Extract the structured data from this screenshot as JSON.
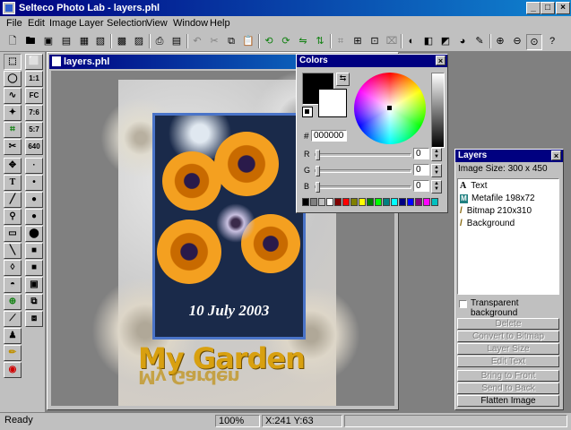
{
  "window": {
    "title": "Selteco Photo Lab - layers.phl",
    "min": "_",
    "max": "□",
    "close": "×"
  },
  "menu": [
    "File",
    "Edit",
    "Image",
    "Layer",
    "Selection",
    "View",
    "Window",
    "Help"
  ],
  "document": {
    "title": "layers.phl",
    "date_caption": "10 July 2003",
    "garden_text": "My Garden"
  },
  "colors_panel": {
    "title": "Colors",
    "hex_prefix": "#",
    "hex_value": "000000",
    "channels": [
      {
        "label": "R",
        "value": "0"
      },
      {
        "label": "G",
        "value": "0"
      },
      {
        "label": "B",
        "value": "0"
      }
    ],
    "swatches": [
      "#000000",
      "#808080",
      "#c0c0c0",
      "#ffffff",
      "#800000",
      "#ff0000",
      "#808000",
      "#ffff00",
      "#008000",
      "#00ff00",
      "#008080",
      "#00ffff",
      "#000080",
      "#0000ff",
      "#800080",
      "#ff00ff",
      "#00c0c0"
    ]
  },
  "layers_panel": {
    "title": "Layers",
    "image_size": "Image Size: 300 x 450",
    "items": [
      {
        "icon": "A",
        "label": "Text"
      },
      {
        "icon": "M",
        "label": "Metafile 198x72"
      },
      {
        "icon": "/",
        "label": "Bitmap 210x310"
      },
      {
        "icon": "/",
        "label": "Background"
      }
    ],
    "transparent_label": "Transparent background",
    "buttons": [
      "Delete",
      "Convert to Bitmap",
      "Layer Size",
      "Edit Text",
      "Bring to Front",
      "Send to Back",
      "Flatten Image"
    ]
  },
  "status": {
    "text": "Ready",
    "zoom": "100%",
    "coords": "X:241 Y:63"
  }
}
